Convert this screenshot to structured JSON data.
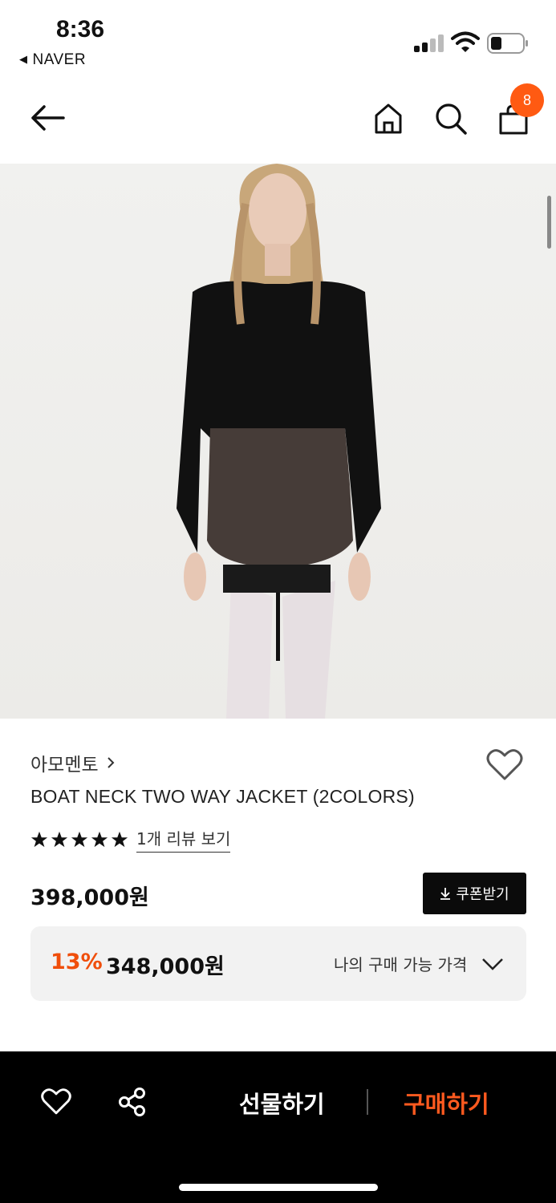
{
  "status_bar": {
    "time": "8:36",
    "back_app": "NAVER"
  },
  "nav": {
    "cart_count": "8"
  },
  "product": {
    "brand": "아모멘토",
    "title": "BOAT NECK TWO WAY JACKET (2COLORS)",
    "rating_stars": 5,
    "review_link": "1개 리뷰 보기",
    "price": "398,000원",
    "coupon_button": "쿠폰받기",
    "discount_percent": "13%",
    "sale_price": "348,000원",
    "my_price_label": "나의 구매 가능 가격"
  },
  "bottom_bar": {
    "gift_label": "선물하기",
    "buy_label": "구매하기"
  },
  "colors": {
    "accent": "#ff5a12",
    "sale": "#f04e0b",
    "buy": "#ff5a1f"
  }
}
